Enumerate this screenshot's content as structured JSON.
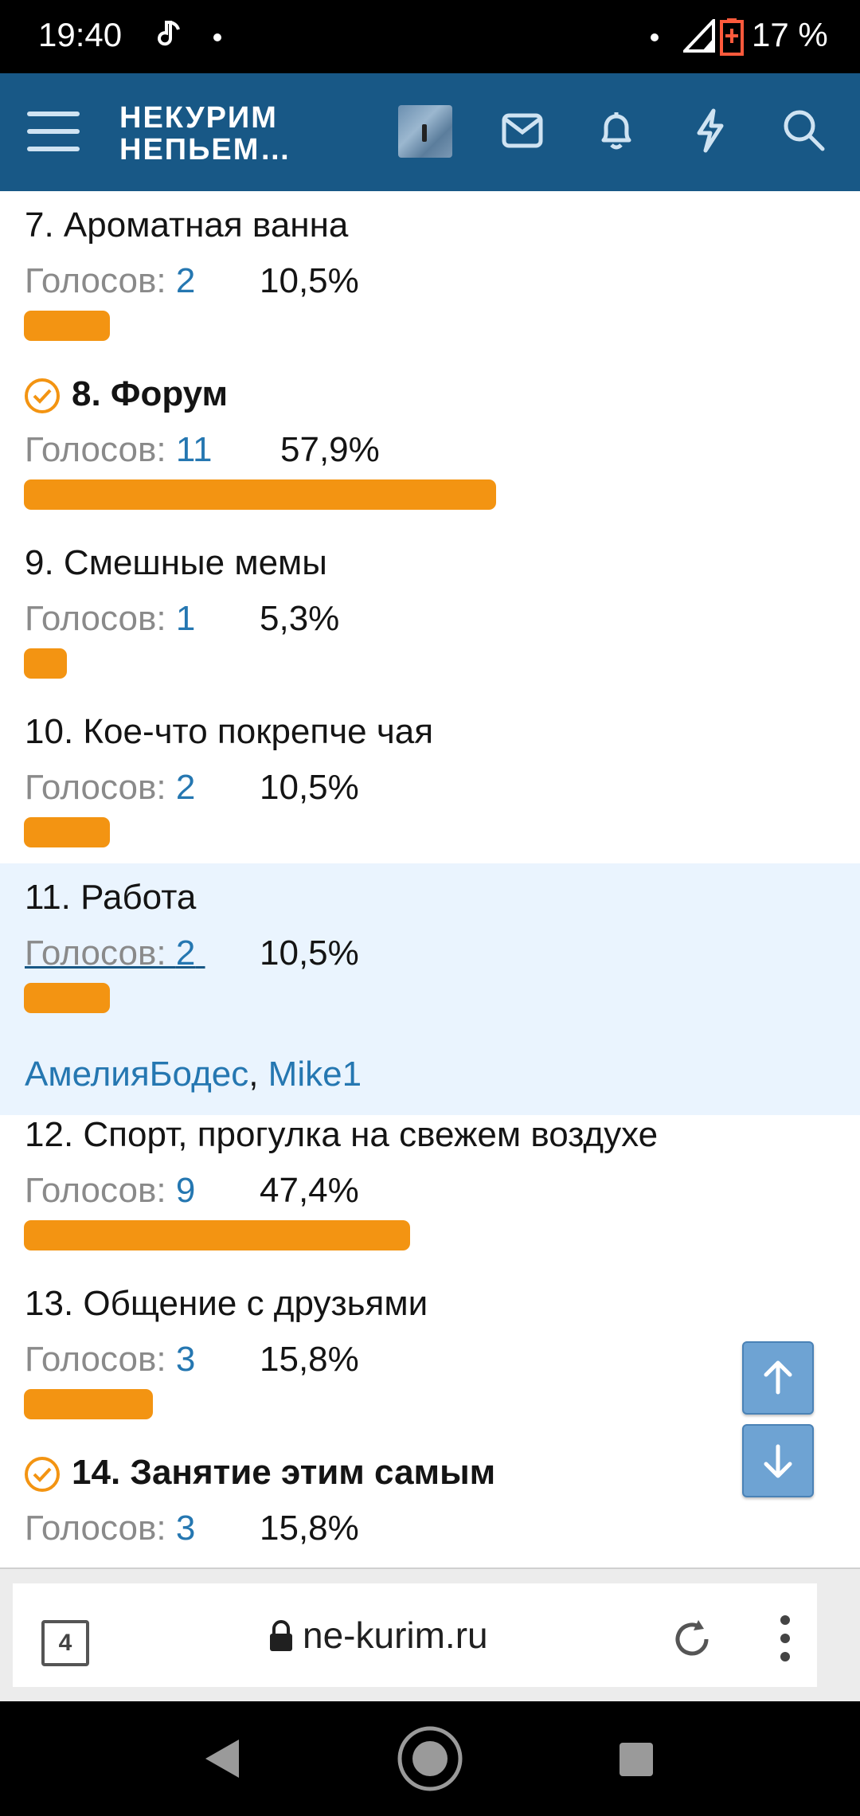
{
  "status": {
    "time": "19:40",
    "battery": "17 %"
  },
  "app": {
    "logo_line1": "НЕКУРИМ",
    "logo_line2": "НЕПЬЕМ…"
  },
  "poll": [
    {
      "title": "7. Ароматная ванна",
      "votes_label": "Голосов: ",
      "votes": "2",
      "percent": "10,5%",
      "share": 0.105,
      "chosen": false
    },
    {
      "title": "8. Форум",
      "votes_label": "Голосов: ",
      "votes": "11",
      "percent": "57,9%",
      "share": 0.579,
      "chosen": true
    },
    {
      "title": "9. Смешные мемы",
      "votes_label": "Голосов: ",
      "votes": "1",
      "percent": "5,3%",
      "share": 0.053,
      "chosen": false
    },
    {
      "title": "10. Кое-что покрепче чая",
      "votes_label": "Голосов: ",
      "votes": "2",
      "percent": "10,5%",
      "share": 0.105,
      "chosen": false
    },
    {
      "title": "11. Работа",
      "votes_label": "Голосов: ",
      "votes": "2",
      "percent": "10,5%",
      "share": 0.105,
      "chosen": false,
      "voters": [
        "АмелияБодес",
        "Mike1"
      ]
    },
    {
      "title": "12. Спорт, прогулка на свежем воздухе",
      "votes_label": "Голосов: ",
      "votes": "9",
      "percent": "47,4%",
      "share": 0.474,
      "chosen": false
    },
    {
      "title": "13. Общение с друзьями",
      "votes_label": "Голосов: ",
      "votes": "3",
      "percent": "15,8%",
      "share": 0.158,
      "chosen": false
    },
    {
      "title": "14. Занятие этим самым",
      "votes_label": "Голосов: ",
      "votes": "3",
      "percent": "15,8%",
      "share": 0.158,
      "chosen": true
    }
  ],
  "voters_separator": ", ",
  "browser": {
    "tab_count": "4",
    "url": "ne-kurim.ru"
  },
  "icons": [
    "menu-icon",
    "mail-icon",
    "bell-icon",
    "lightning-icon",
    "search-icon",
    "check-circle-icon",
    "arrow-up-icon",
    "arrow-down-icon",
    "lock-icon",
    "reload-icon",
    "more-vert-icon",
    "back-icon",
    "home-icon",
    "recents-icon"
  ],
  "colors": {
    "appbar": "#185886",
    "bar": "#f39412",
    "link": "#2577b1",
    "highlight": "#eaf4fe"
  }
}
